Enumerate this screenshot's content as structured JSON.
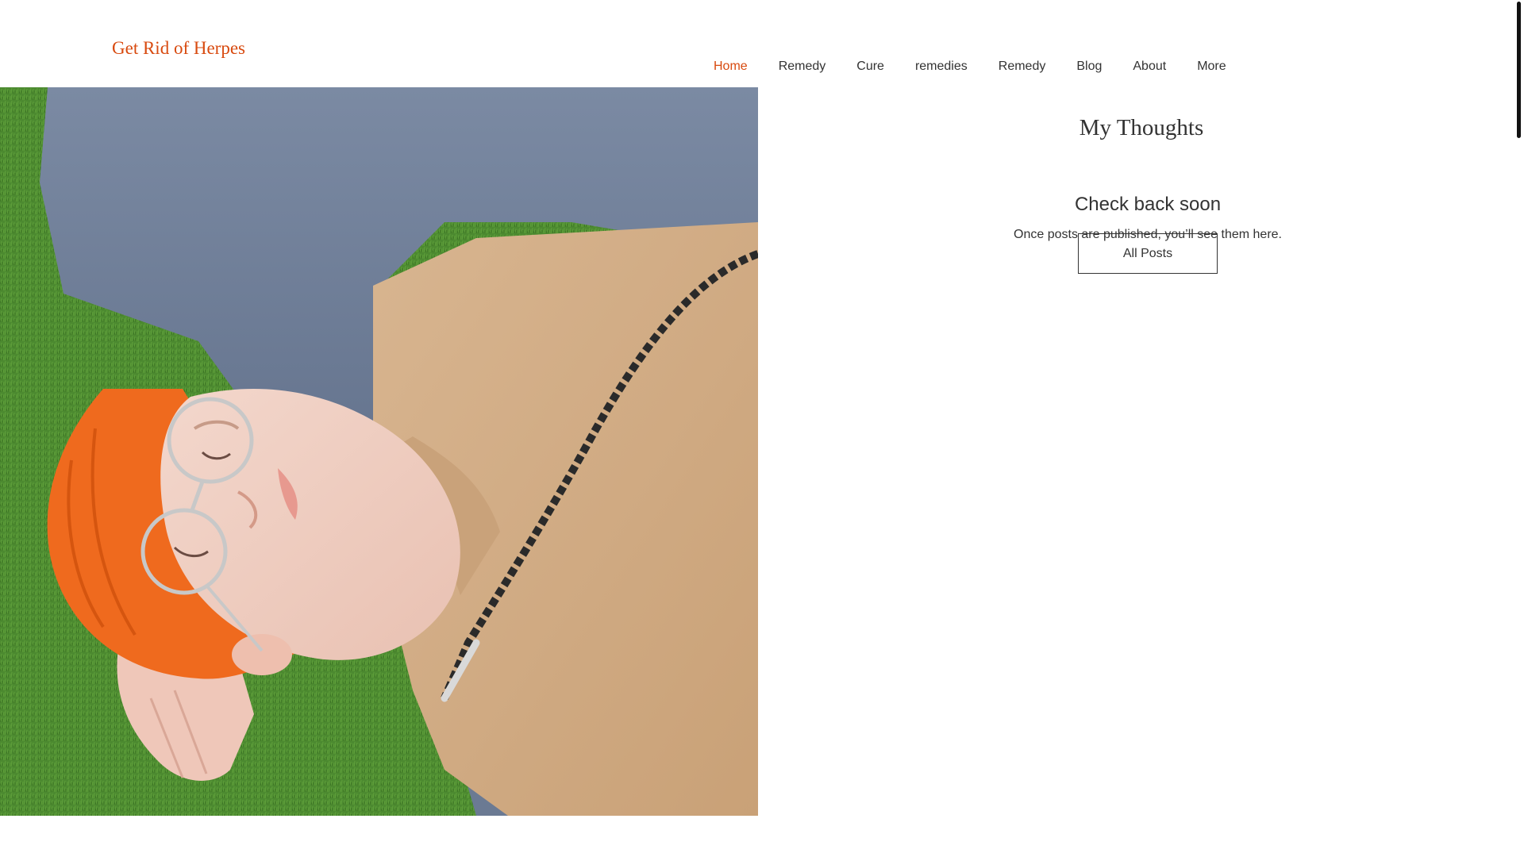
{
  "site": {
    "title": "Get Rid of Herpes",
    "accent_color": "#d84a0f",
    "text_color": "#333333"
  },
  "nav": {
    "items": [
      {
        "label": "Home",
        "active": true
      },
      {
        "label": "Remedy",
        "active": false
      },
      {
        "label": "Cure",
        "active": false
      },
      {
        "label": "remedies",
        "active": false
      },
      {
        "label": "Remedy",
        "active": false
      },
      {
        "label": "Blog",
        "active": false
      },
      {
        "label": "About",
        "active": false
      },
      {
        "label": "More",
        "active": false
      }
    ]
  },
  "hero": {
    "image": "photo of a person lying on grass wearing glasses, orange beanie and beige sweatshirt"
  },
  "blog": {
    "title": "My Thoughts",
    "empty_title": "Check back soon",
    "empty_text": "Once posts are published, you’ll see them here.",
    "all_posts_label": "All Posts"
  }
}
